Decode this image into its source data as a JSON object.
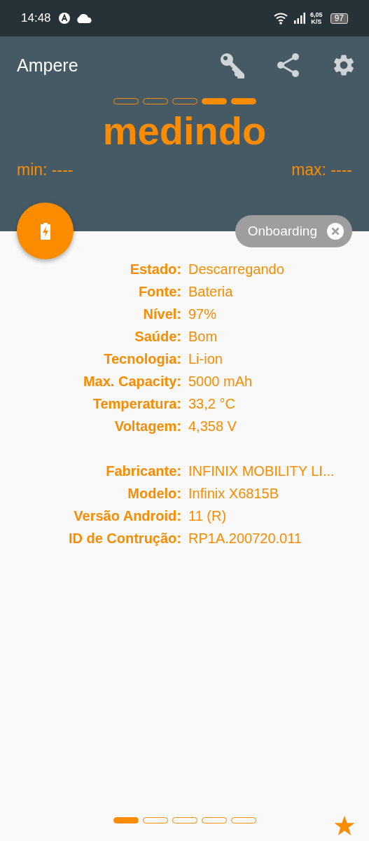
{
  "status_bar": {
    "time": "14:48",
    "speed_value": "6,05",
    "speed_unit": "K/S",
    "battery": "97"
  },
  "app_bar": {
    "title": "Ampere"
  },
  "header": {
    "progress_segments": [
      {
        "filled": false
      },
      {
        "filled": false
      },
      {
        "filled": false
      },
      {
        "filled": true
      },
      {
        "filled": true
      }
    ],
    "status": "medindo",
    "min": "min: ----",
    "max": "max: ----"
  },
  "onboarding_chip": {
    "label": "Onboarding"
  },
  "info_groups": [
    [
      {
        "label": "Estado:",
        "value": "Descarregando"
      },
      {
        "label": "Fonte:",
        "value": "Bateria"
      },
      {
        "label": "Nível:",
        "value": "97%"
      },
      {
        "label": "Saúde:",
        "value": "Bom"
      },
      {
        "label": "Tecnologia:",
        "value": "Li-ion"
      },
      {
        "label": "Max. Capacity:",
        "value": "5000 mAh"
      },
      {
        "label": "Temperatura:",
        "value": "33,2 °C"
      },
      {
        "label": "Voltagem:",
        "value": "4,358 V"
      }
    ],
    [
      {
        "label": "Fabricante:",
        "value": "INFINIX MOBILITY LI..."
      },
      {
        "label": "Modelo:",
        "value": "Infinix X6815B"
      },
      {
        "label": "Versão Android:",
        "value": "11 (R)"
      },
      {
        "label": "ID de Contrução:",
        "value": "RP1A.200720.011"
      }
    ]
  ],
  "page_indicator": [
    {
      "selected": true
    },
    {
      "selected": false
    },
    {
      "selected": false
    },
    {
      "selected": false
    },
    {
      "selected": false
    }
  ]
}
